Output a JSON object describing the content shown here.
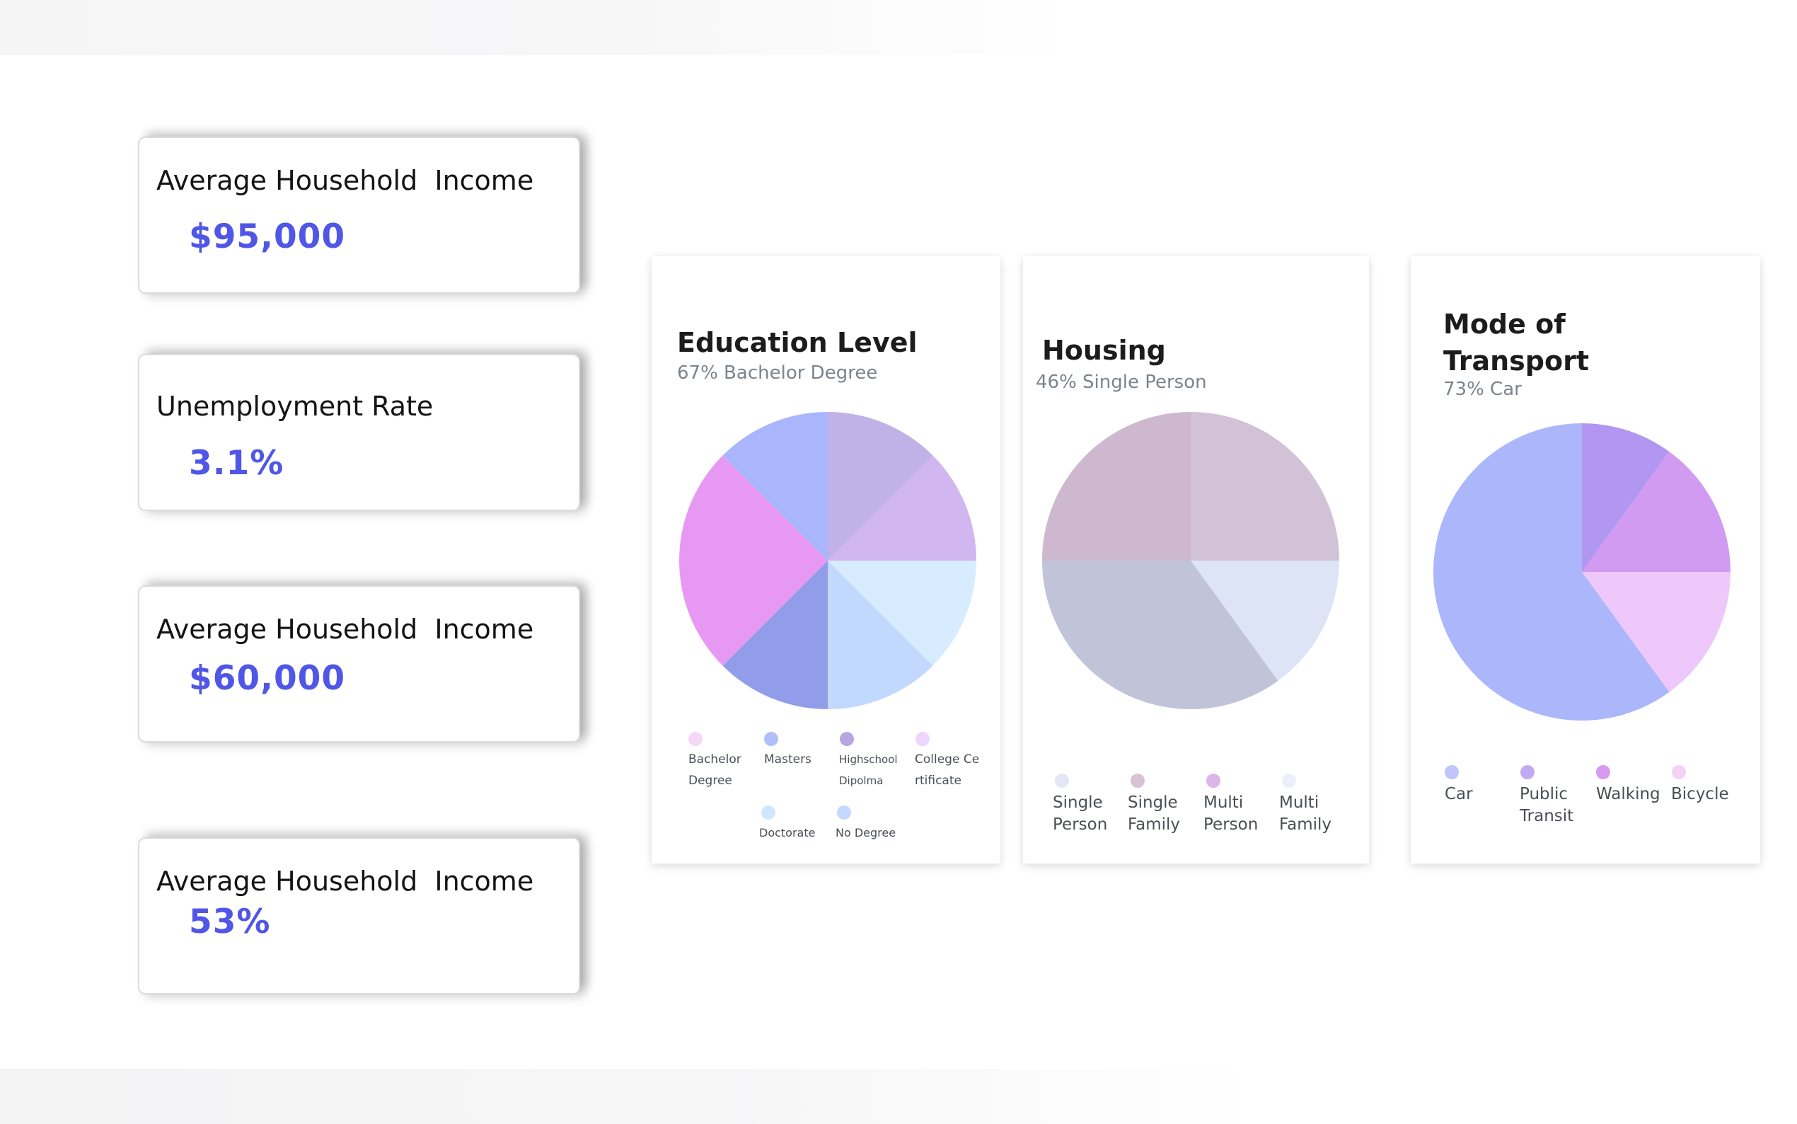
{
  "stats": [
    {
      "title": "Average Household  Income",
      "value": "$95,000"
    },
    {
      "title": "Unemployment Rate",
      "value": "3.1%"
    },
    {
      "title": "Average Household  Income",
      "value": "$60,000"
    },
    {
      "title": "Average Household  Income",
      "value": "53%"
    }
  ],
  "chart_data": [
    {
      "type": "pie",
      "title": "Education Level",
      "subtitle": "67% Bachelor Degree",
      "slices": [
        {
          "color": "#c0b2e6"
        },
        {
          "color": "#d2b6ef"
        },
        {
          "color": "#d8ecff"
        },
        {
          "color": "#c2d8ff"
        },
        {
          "color": "#919de9"
        },
        {
          "color": "#e798f3"
        },
        {
          "color": "#aab6fb"
        }
      ],
      "values": [
        12.5,
        12.5,
        12.5,
        12.5,
        12.5,
        25,
        12.5
      ],
      "legend": [
        {
          "label": "Bachelor Degree",
          "color": "#f5d8f6"
        },
        {
          "label": "Masters",
          "color": "#b2bef8"
        },
        {
          "label": "Highschool Dipolma",
          "color": "#b7a6e0"
        },
        {
          "label": "College Certificate",
          "color": "#ecd6fb"
        },
        {
          "label": "Doctorate",
          "color": "#cfe6ff"
        },
        {
          "label": "No Degree",
          "color": "#c5d8ff"
        }
      ]
    },
    {
      "type": "pie",
      "title": "Housing",
      "subtitle": "46% Single Person",
      "slices": [
        {
          "color": "#d2c2d7"
        },
        {
          "color": "#dde4f6"
        },
        {
          "color": "#c1c4d9"
        },
        {
          "color": "#cdb8cf"
        }
      ],
      "values": [
        25,
        15,
        35,
        25
      ],
      "legend": [
        {
          "label": "Single Person",
          "color": "#e4e6f6"
        },
        {
          "label": "Single Family",
          "color": "#d8c2d6"
        },
        {
          "label": "Multi Person",
          "color": "#ddb4e8"
        },
        {
          "label": "Multi Family",
          "color": "#eeeefa"
        }
      ]
    },
    {
      "type": "pie",
      "title": "Mode of Transport",
      "subtitle": "73% Car",
      "slices": [
        {
          "color": "#b196f2"
        },
        {
          "color": "#d19bf1"
        },
        {
          "color": "#eec8fb"
        },
        {
          "color": "#abb6fb"
        }
      ],
      "values": [
        10,
        15,
        15,
        60
      ],
      "legend": [
        {
          "label": "Car",
          "color": "#c1c6fa"
        },
        {
          "label": "Public Transit",
          "color": "#c1aaf2"
        },
        {
          "label": "Walking",
          "color": "#d79af0"
        },
        {
          "label": "Bicycle",
          "color": "#f4d2f8"
        }
      ]
    }
  ]
}
